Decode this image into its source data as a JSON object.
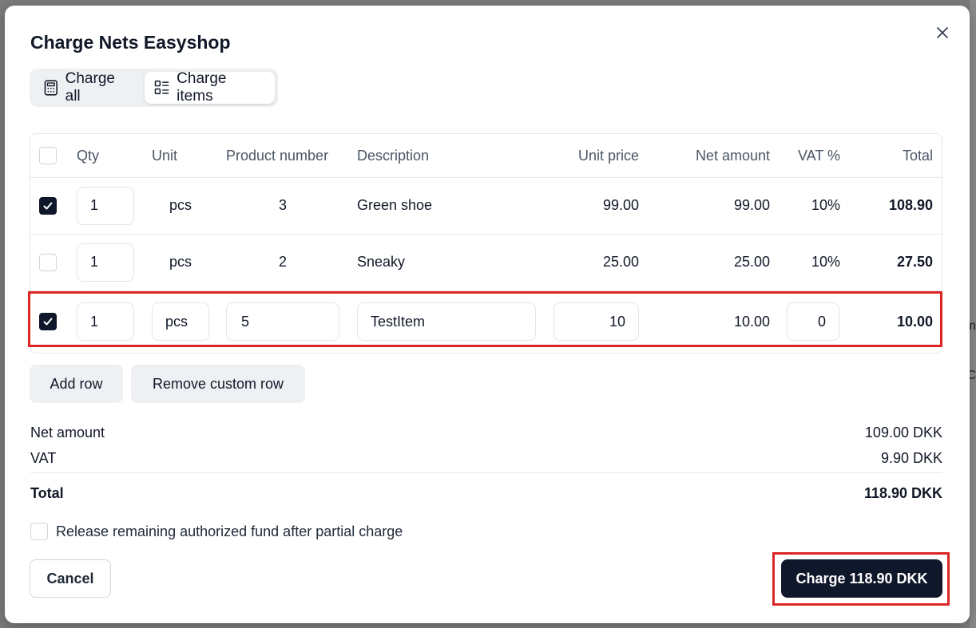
{
  "modal": {
    "title": "Charge Nets Easyshop",
    "tabs": [
      {
        "label": "Charge all",
        "icon": "calculator-icon",
        "active": false
      },
      {
        "label": "Charge items",
        "icon": "list-items-icon",
        "active": true
      }
    ]
  },
  "table": {
    "headers": {
      "qty": "Qty",
      "unit": "Unit",
      "product_number": "Product number",
      "description": "Description",
      "unit_price": "Unit price",
      "net_amount": "Net amount",
      "vat": "VAT %",
      "total": "Total"
    },
    "rows": [
      {
        "checked": true,
        "qty": "1",
        "unit": "pcs",
        "product_number": "3",
        "description": "Green shoe",
        "unit_price": "99.00",
        "net_amount": "99.00",
        "vat": "10%",
        "total": "108.90"
      },
      {
        "checked": false,
        "qty": "1",
        "unit": "pcs",
        "product_number": "2",
        "description": "Sneaky",
        "unit_price": "25.00",
        "net_amount": "25.00",
        "vat": "10%",
        "total": "27.50"
      },
      {
        "checked": true,
        "qty": "1",
        "unit": "pcs",
        "product_number": "5",
        "description": "TestItem",
        "unit_price": "10",
        "net_amount": "10.00",
        "vat": "0",
        "total": "10.00"
      }
    ]
  },
  "actions": {
    "add_row": "Add row",
    "remove_custom_row": "Remove custom row"
  },
  "summary": {
    "net_amount_label": "Net amount",
    "net_amount_value": "109.00 DKK",
    "vat_label": "VAT",
    "vat_value": "9.90 DKK",
    "total_label": "Total",
    "total_value": "118.90 DKK"
  },
  "release": {
    "label": "Release remaining authorized fund after partial charge",
    "checked": false
  },
  "footer": {
    "cancel": "Cancel",
    "charge": "Charge 118.90 DKK"
  },
  "background": {
    "glyph1": "n",
    "glyph2": "C"
  },
  "colors": {
    "primary": "#0f172a",
    "highlight": "#dc2626"
  }
}
